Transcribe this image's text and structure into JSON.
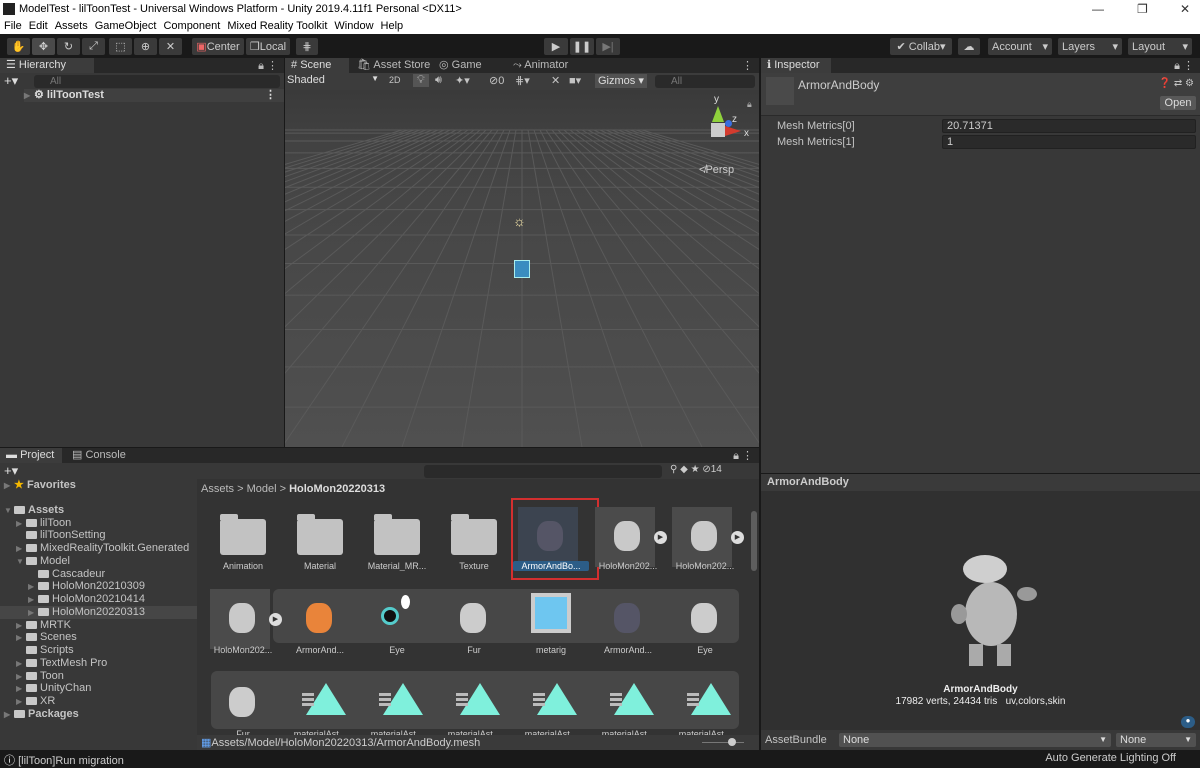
{
  "window": {
    "title": "ModelTest - lilToonTest - Universal Windows Platform - Unity 2019.4.11f1 Personal <DX11>"
  },
  "menu": [
    "File",
    "Edit",
    "Assets",
    "GameObject",
    "Component",
    "Mixed Reality Toolkit",
    "Window",
    "Help"
  ],
  "toolbar": {
    "pivot": "Center",
    "space": "Local",
    "collab": "Collab",
    "account": "Account",
    "layers": "Layers",
    "layout": "Layout"
  },
  "hierarchy": {
    "tab": "Hierarchy",
    "search_placeholder": "All",
    "items": [
      "lilToonTest"
    ]
  },
  "scene": {
    "tabs": [
      "Scene",
      "Asset Store",
      "Game",
      "Animator"
    ],
    "shading": "Shaded",
    "mode2d": "2D",
    "hidden_count": "0",
    "gizmos": "Gizmos",
    "search_placeholder": "All",
    "projection": "Persp",
    "axes": {
      "y": "y",
      "z": "z",
      "x": "x"
    }
  },
  "inspector": {
    "tab": "Inspector",
    "object": "ArmorAndBody",
    "open": "Open",
    "fields": [
      {
        "label": "Mesh Metrics[0]",
        "value": "20.71371"
      },
      {
        "label": "Mesh Metrics[1]",
        "value": "1"
      }
    ],
    "preview_title": "ArmorAndBody",
    "preview_name": "ArmorAndBody",
    "preview_stats": "17982 verts, 24434 tris   uv,colors,skin",
    "assetbundle_label": "AssetBundle",
    "assetbundle_name": "None",
    "assetbundle_variant": "None"
  },
  "project": {
    "tabs": [
      "Project",
      "Console"
    ],
    "hidden_count": "14",
    "tree": [
      {
        "label": "Favorites",
        "depth": 0,
        "arrow": true,
        "star": true
      },
      {
        "label": "Assets",
        "depth": 0,
        "arrow": true,
        "open": true
      },
      {
        "label": "lilToon",
        "depth": 1,
        "arrow": true
      },
      {
        "label": "lilToonSetting",
        "depth": 1
      },
      {
        "label": "MixedRealityToolkit.Generated",
        "depth": 1,
        "arrow": true
      },
      {
        "label": "Model",
        "depth": 1,
        "arrow": true,
        "open": true
      },
      {
        "label": "Cascadeur",
        "depth": 2
      },
      {
        "label": "HoloMon20210309",
        "depth": 2,
        "arrow": true
      },
      {
        "label": "HoloMon20210414",
        "depth": 2,
        "arrow": true
      },
      {
        "label": "HoloMon20220313",
        "depth": 2,
        "arrow": true,
        "selected": true
      },
      {
        "label": "MRTK",
        "depth": 1,
        "arrow": true
      },
      {
        "label": "Scenes",
        "depth": 1,
        "arrow": true
      },
      {
        "label": "Scripts",
        "depth": 1
      },
      {
        "label": "TextMesh Pro",
        "depth": 1,
        "arrow": true
      },
      {
        "label": "Toon",
        "depth": 1,
        "arrow": true
      },
      {
        "label": "UnityChan",
        "depth": 1,
        "arrow": true
      },
      {
        "label": "XR",
        "depth": 1,
        "arrow": true
      },
      {
        "label": "Packages",
        "depth": 0,
        "arrow": true
      }
    ],
    "breadcrumb": [
      "Assets",
      "Model",
      "HoloMon20220313"
    ],
    "assets_row1": [
      {
        "label": "Animation",
        "kind": "folder"
      },
      {
        "label": "Material",
        "kind": "folder"
      },
      {
        "label": "Material_MR...",
        "kind": "folder"
      },
      {
        "label": "Texture",
        "kind": "folder"
      },
      {
        "label": "ArmorAndBo...",
        "kind": "mesh",
        "selected": true
      },
      {
        "label": "HoloMon202...",
        "kind": "model"
      },
      {
        "label": "HoloMon202...",
        "kind": "model"
      }
    ],
    "assets_row2": [
      {
        "label": "HoloMon202...",
        "kind": "model"
      },
      {
        "label": "ArmorAnd...",
        "kind": "mesh-color"
      },
      {
        "label": "Eye",
        "kind": "eye"
      },
      {
        "label": "Fur",
        "kind": "fur"
      },
      {
        "label": "metarig",
        "kind": "prefab"
      },
      {
        "label": "ArmorAnd...",
        "kind": "mesh"
      },
      {
        "label": "Eye",
        "kind": "eye-mesh"
      }
    ],
    "assets_row3": [
      {
        "label": "Fur",
        "kind": "fur-mesh"
      },
      {
        "label": "materialAst...",
        "kind": "anim"
      },
      {
        "label": "materialAst...",
        "kind": "anim"
      },
      {
        "label": "materialAst...",
        "kind": "anim"
      },
      {
        "label": "materialAst...",
        "kind": "anim"
      },
      {
        "label": "materialAst...",
        "kind": "anim"
      },
      {
        "label": "materialAst...",
        "kind": "anim"
      }
    ],
    "selected_path": "Assets/Model/HoloMon20220313/ArmorAndBody.mesh"
  },
  "status": {
    "message": "[lilToon]Run migration",
    "lighting": "Auto Generate Lighting Off"
  },
  "colors": {
    "highlight": "#d32f2f",
    "selection": "#2c5d87",
    "accent_teal": "#7ff0dc"
  }
}
